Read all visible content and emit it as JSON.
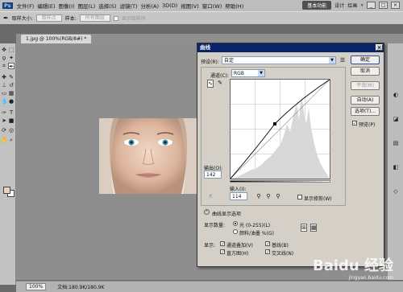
{
  "menu": {
    "logo": "Ps",
    "items": [
      "文件(F)",
      "编辑(E)",
      "图像(I)",
      "图层(L)",
      "选择(S)",
      "滤镜(T)",
      "分析(A)",
      "3D(D)",
      "视图(V)",
      "窗口(W)",
      "帮助(H)"
    ],
    "zoom": "100%",
    "workspace": "基本功能",
    "ws_design": "设计",
    "ws_paint": "绘画",
    "more": "»"
  },
  "options": {
    "sample_size_label": "取样大小:",
    "sample_size_value": "取样点",
    "sample_label": "样本:",
    "sample_value": "所有图层",
    "show_ring": "显示取样环"
  },
  "doc_tab": "1.jpg @ 100%(RGB/8#) *",
  "status": {
    "zoom": "100%",
    "doc": "文档:180.9K/180.9K"
  },
  "curves": {
    "title": "曲线",
    "preset_label": "预设(R):",
    "preset_value": "自定",
    "channel_label": "通道(C):",
    "channel_value": "RGB",
    "output_label": "输出(O):",
    "output_value": "142",
    "input_label": "输入(I):",
    "input_value": "114",
    "show_clipping": "显示修剪(W)",
    "display_options": "曲线显示选项",
    "show_amount": "显示数量:",
    "light": "光 (0-255)(L)",
    "pigment": "颜料/油墨 %(G)",
    "show": "显示:",
    "channel_overlay": "通道叠加(V)",
    "baseline": "基线(B)",
    "histogram": "直方图(H)",
    "intersection": "交叉线(N)",
    "buttons": {
      "ok": "确定",
      "cancel": "取消",
      "smooth": "平滑(M)",
      "auto": "自动(A)",
      "options": "选项(T)...",
      "preview": "预览(P)"
    }
  },
  "watermark": {
    "main": "Baidu 经验",
    "sub": "jingyan.baidu.com"
  },
  "colors": {
    "title_bar": "#0a246a",
    "foreground": "#e7d3c2"
  }
}
